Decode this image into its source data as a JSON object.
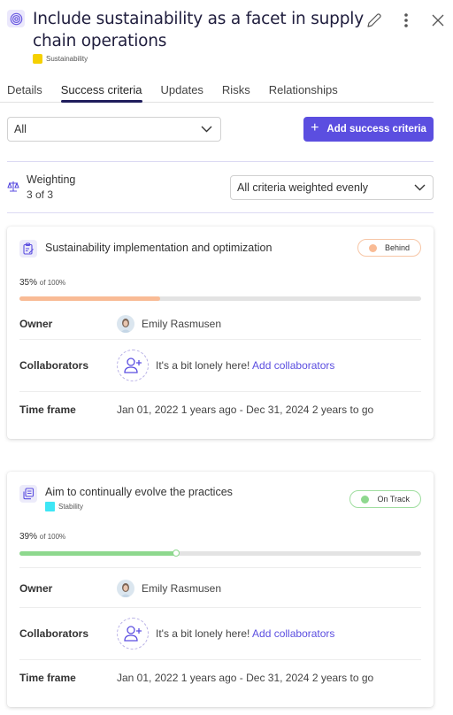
{
  "header": {
    "title": "Include sustainability as a facet in supply chain operations",
    "category": {
      "label": "Sustainability",
      "color": "#f5d000"
    },
    "icon": "target-icon",
    "actions": [
      "pencil-icon",
      "more-vertical-icon",
      "close-icon"
    ]
  },
  "tabs": [
    {
      "label": "Details",
      "active": false
    },
    {
      "label": "Success criteria",
      "active": true
    },
    {
      "label": "Updates",
      "active": false
    },
    {
      "label": "Risks",
      "active": false
    },
    {
      "label": "Relationships",
      "active": false
    }
  ],
  "filter": {
    "value": "All"
  },
  "add_button": {
    "label": "Add success criteria",
    "icon": "plus-icon",
    "color": "#5b4ee0"
  },
  "weighting": {
    "label": "Weighting",
    "count": "3 of 3",
    "icon": "scale-icon",
    "select_value": "All criteria weighted evenly"
  },
  "criteria": [
    {
      "title": "Sustainability implementation and optimization",
      "icon": "clipboard-edit-icon",
      "category": null,
      "status": {
        "label": "Behind",
        "color": "#f9bb95",
        "border": "#f7c6a6"
      },
      "progress": {
        "value_label": "35%",
        "of_label": "of 100%",
        "percent": 35,
        "color": "#f9bb95"
      },
      "owner_label": "Owner",
      "owner": "Emily Rasmusen",
      "collaborators_label": "Collaborators",
      "collaborators_text": "It's a bit lonely here!",
      "collaborators_link": "Add collaborators",
      "timeframe_label": "Time frame",
      "timeframe": "Jan 01, 2022 1 years ago - Dec 31, 2024 2 years to go"
    },
    {
      "title": "Aim to continually evolve the practices",
      "icon": "documents-icon",
      "category": {
        "label": "Stability",
        "color": "#3ee6f5"
      },
      "status": {
        "label": "On Track",
        "color": "#8ed88e",
        "border": "#a0dea0"
      },
      "progress": {
        "value_label": "39%",
        "of_label": "of 100%",
        "percent": 39,
        "color": "#8ed88e"
      },
      "owner_label": "Owner",
      "owner": "Emily Rasmusen",
      "collaborators_label": "Collaborators",
      "collaborators_text": "It's a bit lonely here!",
      "collaborators_link": "Add collaborators",
      "timeframe_label": "Time frame",
      "timeframe": "Jan 01, 2022 1 years ago - Dec 31, 2024 2 years to go"
    }
  ]
}
